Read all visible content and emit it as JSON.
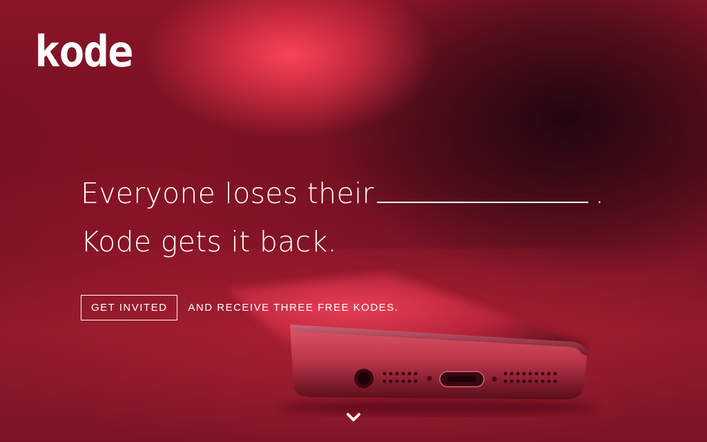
{
  "brand": {
    "logo_text": "kode"
  },
  "hero": {
    "headline_line1_prefix": "Everyone loses their",
    "headline_line1_suffix": ".",
    "headline_line2": "Kode gets it back."
  },
  "cta": {
    "button_label": "GET INVITED",
    "tagline": "AND RECEIVE THREE FREE KODES."
  },
  "icons": {
    "scroll": "chevron-down-icon",
    "phone": "phone-illustration"
  },
  "colors": {
    "background": "#7d1224",
    "highlight": "#f0374e",
    "text": "#ffffff"
  }
}
